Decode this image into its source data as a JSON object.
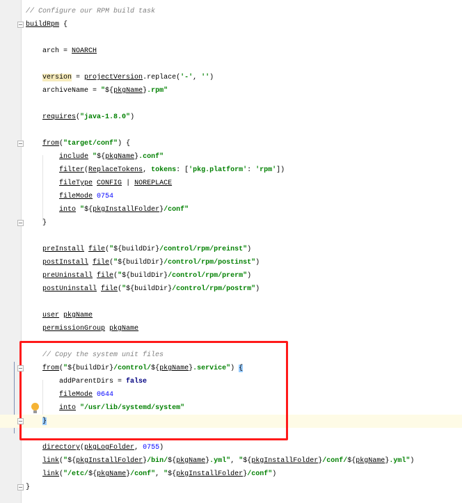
{
  "editor": {
    "language": "groovy",
    "current_line": 31,
    "annotation_box_color": "#ff1a1a",
    "lines": [
      {
        "tokens": [
          {
            "t": "// Configure our RPM build task",
            "s": "c"
          }
        ]
      },
      {
        "tokens": [
          {
            "t": "buildRpm",
            "s": "u"
          },
          {
            "t": " {",
            "s": ""
          }
        ]
      },
      {
        "tokens": []
      },
      {
        "tokens": [
          {
            "t": "    arch = ",
            "s": ""
          },
          {
            "t": "NOARCH",
            "s": "u"
          }
        ]
      },
      {
        "tokens": []
      },
      {
        "tokens": [
          {
            "t": "    ",
            "s": ""
          },
          {
            "t": "version",
            "s": "hl"
          },
          {
            "t": " = ",
            "s": ""
          },
          {
            "t": "projectVersion",
            "s": "u"
          },
          {
            "t": ".replace(",
            "s": ""
          },
          {
            "t": "'-'",
            "s": "s"
          },
          {
            "t": ", ",
            "s": ""
          },
          {
            "t": "''",
            "s": "s"
          },
          {
            "t": ")",
            "s": ""
          }
        ]
      },
      {
        "tokens": [
          {
            "t": "    archiveName = ",
            "s": ""
          },
          {
            "t": "\"",
            "s": "s"
          },
          {
            "t": "${",
            "s": ""
          },
          {
            "t": "pkgName",
            "s": "u"
          },
          {
            "t": "}",
            "s": ""
          },
          {
            "t": ".rpm\"",
            "s": "s"
          }
        ]
      },
      {
        "tokens": []
      },
      {
        "tokens": [
          {
            "t": "    ",
            "s": ""
          },
          {
            "t": "requires",
            "s": "u"
          },
          {
            "t": "(",
            "s": ""
          },
          {
            "t": "\"java-1.8.0\"",
            "s": "s"
          },
          {
            "t": ")",
            "s": ""
          }
        ]
      },
      {
        "tokens": []
      },
      {
        "tokens": [
          {
            "t": "    ",
            "s": ""
          },
          {
            "t": "from",
            "s": "u"
          },
          {
            "t": "(",
            "s": ""
          },
          {
            "t": "\"target/conf\"",
            "s": "s"
          },
          {
            "t": ") {",
            "s": ""
          }
        ]
      },
      {
        "tokens": [
          {
            "t": "        ",
            "s": ""
          },
          {
            "t": "include",
            "s": "u"
          },
          {
            "t": " ",
            "s": ""
          },
          {
            "t": "\"",
            "s": "s"
          },
          {
            "t": "${",
            "s": ""
          },
          {
            "t": "pkgName",
            "s": "u"
          },
          {
            "t": "}",
            "s": ""
          },
          {
            "t": ".conf\"",
            "s": "s"
          }
        ]
      },
      {
        "tokens": [
          {
            "t": "        ",
            "s": ""
          },
          {
            "t": "filter",
            "s": "u"
          },
          {
            "t": "(",
            "s": ""
          },
          {
            "t": "ReplaceTokens",
            "s": "u"
          },
          {
            "t": ", ",
            "s": ""
          },
          {
            "t": "tokens",
            "s": "s"
          },
          {
            "t": ": [",
            "s": ""
          },
          {
            "t": "'pkg.platform'",
            "s": "s"
          },
          {
            "t": ": ",
            "s": ""
          },
          {
            "t": "'rpm'",
            "s": "s"
          },
          {
            "t": "])",
            "s": ""
          }
        ]
      },
      {
        "tokens": [
          {
            "t": "        ",
            "s": ""
          },
          {
            "t": "fileType",
            "s": "u"
          },
          {
            "t": " ",
            "s": ""
          },
          {
            "t": "CONFIG",
            "s": "u"
          },
          {
            "t": " | ",
            "s": ""
          },
          {
            "t": "NOREPLACE",
            "s": "u"
          }
        ]
      },
      {
        "tokens": [
          {
            "t": "        ",
            "s": ""
          },
          {
            "t": "fileMode",
            "s": "u"
          },
          {
            "t": " ",
            "s": ""
          },
          {
            "t": "0754",
            "s": "n"
          }
        ]
      },
      {
        "tokens": [
          {
            "t": "        ",
            "s": ""
          },
          {
            "t": "into",
            "s": "u"
          },
          {
            "t": " ",
            "s": ""
          },
          {
            "t": "\"",
            "s": "s"
          },
          {
            "t": "${",
            "s": ""
          },
          {
            "t": "pkgInstallFolder",
            "s": "u"
          },
          {
            "t": "}",
            "s": ""
          },
          {
            "t": "/conf\"",
            "s": "s"
          }
        ]
      },
      {
        "tokens": [
          {
            "t": "    }",
            "s": ""
          }
        ]
      },
      {
        "tokens": []
      },
      {
        "tokens": [
          {
            "t": "    ",
            "s": ""
          },
          {
            "t": "preInstall",
            "s": "u"
          },
          {
            "t": " ",
            "s": ""
          },
          {
            "t": "file",
            "s": "u"
          },
          {
            "t": "(",
            "s": ""
          },
          {
            "t": "\"",
            "s": "s"
          },
          {
            "t": "${buildDir}",
            "s": ""
          },
          {
            "t": "/control/rpm/preinst\"",
            "s": "s"
          },
          {
            "t": ")",
            "s": ""
          }
        ]
      },
      {
        "tokens": [
          {
            "t": "    ",
            "s": ""
          },
          {
            "t": "postInstall",
            "s": "u"
          },
          {
            "t": " ",
            "s": ""
          },
          {
            "t": "file",
            "s": "u"
          },
          {
            "t": "(",
            "s": ""
          },
          {
            "t": "\"",
            "s": "s"
          },
          {
            "t": "${buildDir}",
            "s": ""
          },
          {
            "t": "/control/rpm/postinst\"",
            "s": "s"
          },
          {
            "t": ")",
            "s": ""
          }
        ]
      },
      {
        "tokens": [
          {
            "t": "    ",
            "s": ""
          },
          {
            "t": "preUninstall",
            "s": "u"
          },
          {
            "t": " ",
            "s": ""
          },
          {
            "t": "file",
            "s": "u"
          },
          {
            "t": "(",
            "s": ""
          },
          {
            "t": "\"",
            "s": "s"
          },
          {
            "t": "${buildDir}",
            "s": ""
          },
          {
            "t": "/control/rpm/prerm\"",
            "s": "s"
          },
          {
            "t": ")",
            "s": ""
          }
        ]
      },
      {
        "tokens": [
          {
            "t": "    ",
            "s": ""
          },
          {
            "t": "postUninstall",
            "s": "u"
          },
          {
            "t": " ",
            "s": ""
          },
          {
            "t": "file",
            "s": "u"
          },
          {
            "t": "(",
            "s": ""
          },
          {
            "t": "\"",
            "s": "s"
          },
          {
            "t": "${buildDir}",
            "s": ""
          },
          {
            "t": "/control/rpm/postrm\"",
            "s": "s"
          },
          {
            "t": ")",
            "s": ""
          }
        ]
      },
      {
        "tokens": []
      },
      {
        "tokens": [
          {
            "t": "    ",
            "s": ""
          },
          {
            "t": "user",
            "s": "u"
          },
          {
            "t": " ",
            "s": ""
          },
          {
            "t": "pkgName",
            "s": "u"
          }
        ]
      },
      {
        "tokens": [
          {
            "t": "    ",
            "s": ""
          },
          {
            "t": "permissionGroup",
            "s": "u"
          },
          {
            "t": " ",
            "s": ""
          },
          {
            "t": "pkgName",
            "s": "u"
          }
        ]
      },
      {
        "tokens": []
      },
      {
        "tokens": [
          {
            "t": "    ",
            "s": ""
          },
          {
            "t": "// Copy the system unit files",
            "s": "c"
          }
        ]
      },
      {
        "tokens": [
          {
            "t": "    ",
            "s": ""
          },
          {
            "t": "from",
            "s": "u"
          },
          {
            "t": "(",
            "s": ""
          },
          {
            "t": "\"",
            "s": "s"
          },
          {
            "t": "${buildDir}",
            "s": ""
          },
          {
            "t": "/control/",
            "s": "s"
          },
          {
            "t": "${",
            "s": ""
          },
          {
            "t": "pkgName",
            "s": "u"
          },
          {
            "t": "}",
            "s": ""
          },
          {
            "t": ".service\"",
            "s": "s"
          },
          {
            "t": ") ",
            "s": ""
          },
          {
            "t": "{",
            "s": "br"
          }
        ]
      },
      {
        "tokens": [
          {
            "t": "        addParentDirs = ",
            "s": ""
          },
          {
            "t": "false",
            "s": "k"
          }
        ]
      },
      {
        "tokens": [
          {
            "t": "        ",
            "s": ""
          },
          {
            "t": "fileMode",
            "s": "u"
          },
          {
            "t": " ",
            "s": ""
          },
          {
            "t": "0644",
            "s": "n"
          }
        ]
      },
      {
        "tokens": [
          {
            "t": "        ",
            "s": ""
          },
          {
            "t": "into",
            "s": "u"
          },
          {
            "t": " ",
            "s": ""
          },
          {
            "t": "\"/usr/lib/systemd/system\"",
            "s": "s"
          }
        ]
      },
      {
        "tokens": [
          {
            "t": "    ",
            "s": ""
          },
          {
            "t": "}",
            "s": "br"
          }
        ]
      },
      {
        "tokens": []
      },
      {
        "tokens": [
          {
            "t": "    ",
            "s": ""
          },
          {
            "t": "directory",
            "s": "u"
          },
          {
            "t": "(",
            "s": ""
          },
          {
            "t": "pkgLogFolder",
            "s": "u"
          },
          {
            "t": ", ",
            "s": ""
          },
          {
            "t": "0755",
            "s": "n"
          },
          {
            "t": ")",
            "s": ""
          }
        ]
      },
      {
        "tokens": [
          {
            "t": "    ",
            "s": ""
          },
          {
            "t": "link",
            "s": "u"
          },
          {
            "t": "(",
            "s": ""
          },
          {
            "t": "\"",
            "s": "s"
          },
          {
            "t": "${",
            "s": ""
          },
          {
            "t": "pkgInstallFolder",
            "s": "u"
          },
          {
            "t": "}",
            "s": ""
          },
          {
            "t": "/bin/",
            "s": "s"
          },
          {
            "t": "${",
            "s": ""
          },
          {
            "t": "pkgName",
            "s": "u"
          },
          {
            "t": "}",
            "s": ""
          },
          {
            "t": ".yml\"",
            "s": "s"
          },
          {
            "t": ", ",
            "s": ""
          },
          {
            "t": "\"",
            "s": "s"
          },
          {
            "t": "${",
            "s": ""
          },
          {
            "t": "pkgInstallFolder",
            "s": "u"
          },
          {
            "t": "}",
            "s": ""
          },
          {
            "t": "/conf/",
            "s": "s"
          },
          {
            "t": "${",
            "s": ""
          },
          {
            "t": "pkgName",
            "s": "u"
          },
          {
            "t": "}",
            "s": ""
          },
          {
            "t": ".yml\"",
            "s": "s"
          },
          {
            "t": ")",
            "s": ""
          }
        ]
      },
      {
        "tokens": [
          {
            "t": "    ",
            "s": ""
          },
          {
            "t": "link",
            "s": "u"
          },
          {
            "t": "(",
            "s": ""
          },
          {
            "t": "\"/etc/",
            "s": "s"
          },
          {
            "t": "${",
            "s": ""
          },
          {
            "t": "pkgName",
            "s": "u"
          },
          {
            "t": "}",
            "s": ""
          },
          {
            "t": "/conf\"",
            "s": "s"
          },
          {
            "t": ", ",
            "s": ""
          },
          {
            "t": "\"",
            "s": "s"
          },
          {
            "t": "${",
            "s": ""
          },
          {
            "t": "pkgInstallFolder",
            "s": "u"
          },
          {
            "t": "}",
            "s": ""
          },
          {
            "t": "/conf\"",
            "s": "s"
          },
          {
            "t": ")",
            "s": ""
          }
        ]
      },
      {
        "tokens": [
          {
            "t": "}",
            "s": ""
          }
        ]
      }
    ],
    "fold_lines": [
      1,
      10,
      16,
      27,
      31,
      36
    ],
    "icons": {
      "fold": "fold-marker-icon",
      "intention": "lightbulb-icon"
    }
  }
}
